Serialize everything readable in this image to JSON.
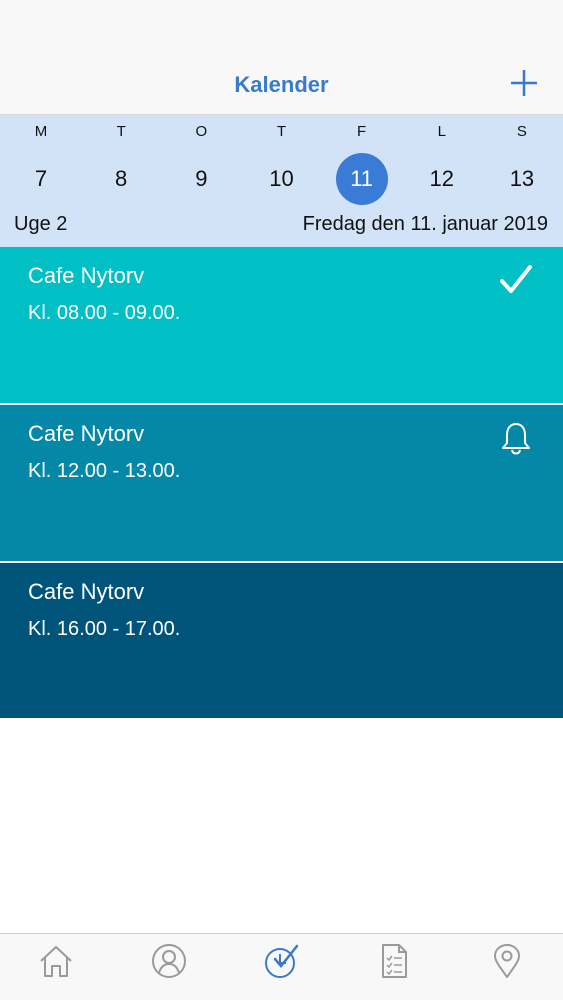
{
  "header": {
    "title": "Kalender",
    "add_icon": "plus-icon"
  },
  "week": {
    "weekdays": [
      "M",
      "T",
      "O",
      "T",
      "F",
      "L",
      "S"
    ],
    "days": [
      "7",
      "8",
      "9",
      "10",
      "11",
      "12",
      "13"
    ],
    "selected_day": "11",
    "week_label": "Uge 2",
    "date_label": "Fredag den 11. januar 2019"
  },
  "events": [
    {
      "title": "Cafe Nytorv",
      "time": "Kl. 08.00 - 09.00.",
      "status_icon": "checkmark-icon",
      "color": "#00bfc5"
    },
    {
      "title": "Cafe Nytorv",
      "time": "Kl. 12.00 - 13.00.",
      "status_icon": "bell-icon",
      "color": "#0588a8"
    },
    {
      "title": "Cafe Nytorv",
      "time": "Kl. 16.00 - 17.00.",
      "status_icon": "",
      "color": "#005479"
    }
  ],
  "tabbar": {
    "items": [
      "home-icon",
      "profile-icon",
      "calendar-check-icon",
      "checklist-icon",
      "location-pin-icon"
    ],
    "active": "calendar-check-icon"
  },
  "colors": {
    "accent": "#3a7bc8",
    "week_background": "#d3e3f7",
    "tab_inactive": "#9a9a9a"
  }
}
